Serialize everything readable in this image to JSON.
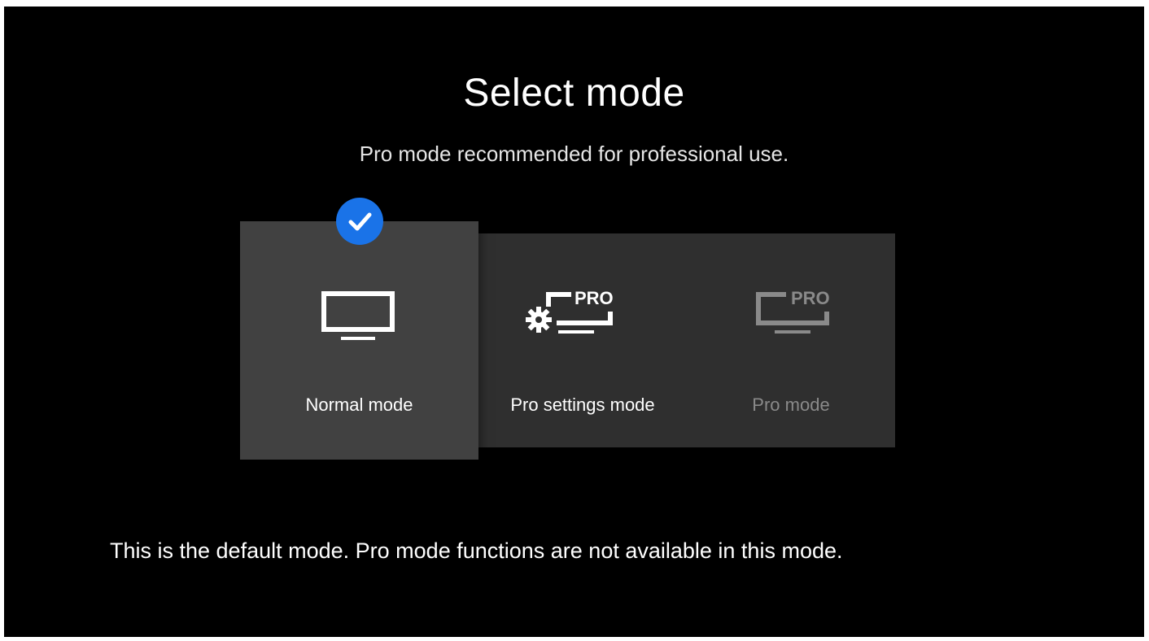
{
  "page": {
    "title": "Select mode",
    "subtitle": "Pro mode recommended for professional use."
  },
  "modes": [
    {
      "label": "Normal mode",
      "icon": "tv-icon",
      "selected": true,
      "enabled": true
    },
    {
      "label": "Pro settings mode",
      "icon": "pro-settings-icon",
      "selected": false,
      "enabled": true
    },
    {
      "label": "Pro mode",
      "icon": "pro-tv-icon",
      "selected": false,
      "enabled": false
    }
  ],
  "selected_indicator": {
    "icon": "check-icon",
    "color": "#1a73e8"
  },
  "description": "This is the default mode. Pro mode functions are not available in this mode.",
  "badge_text": "PRO",
  "colors": {
    "background": "#000000",
    "selected_tile": "#414141",
    "tile_strip": "#2f2f2f",
    "disabled_text": "#8a8a8a",
    "accent": "#1a73e8"
  }
}
